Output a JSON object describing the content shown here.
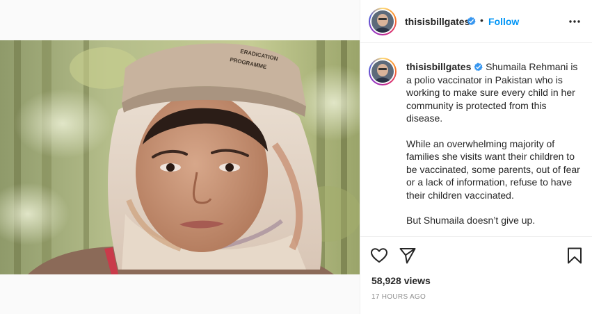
{
  "post": {
    "username": "thisisbillgates",
    "follow_label": "Follow",
    "separator": "•",
    "caption_paragraphs": [
      "Shumaila Rehmani is a polio vaccinator in Pakistan who is working to make sure every child in her community is protected from this disease.",
      "While an overwhelming majority of families she visits want their children to be vaccinated, some parents, out of fear or a lack of information, refuse to have their children vaccinated.",
      "But Shumaila doesn’t give up."
    ],
    "views": "58,928 views",
    "timestamp": "17 HOURS AGO"
  },
  "media": {
    "cap_text_line1": "ERADICATION",
    "cap_text_line2": "PROGRAMME"
  },
  "icons": {
    "verified": "verified-badge-icon",
    "more": "more-options-icon",
    "like": "heart-icon",
    "share": "paper-plane-icon",
    "save": "bookmark-icon"
  },
  "colors": {
    "accent": "#0095f6",
    "verified": "#3897f0",
    "text": "#262626",
    "muted": "#8e8e8e",
    "border": "#efefef"
  }
}
